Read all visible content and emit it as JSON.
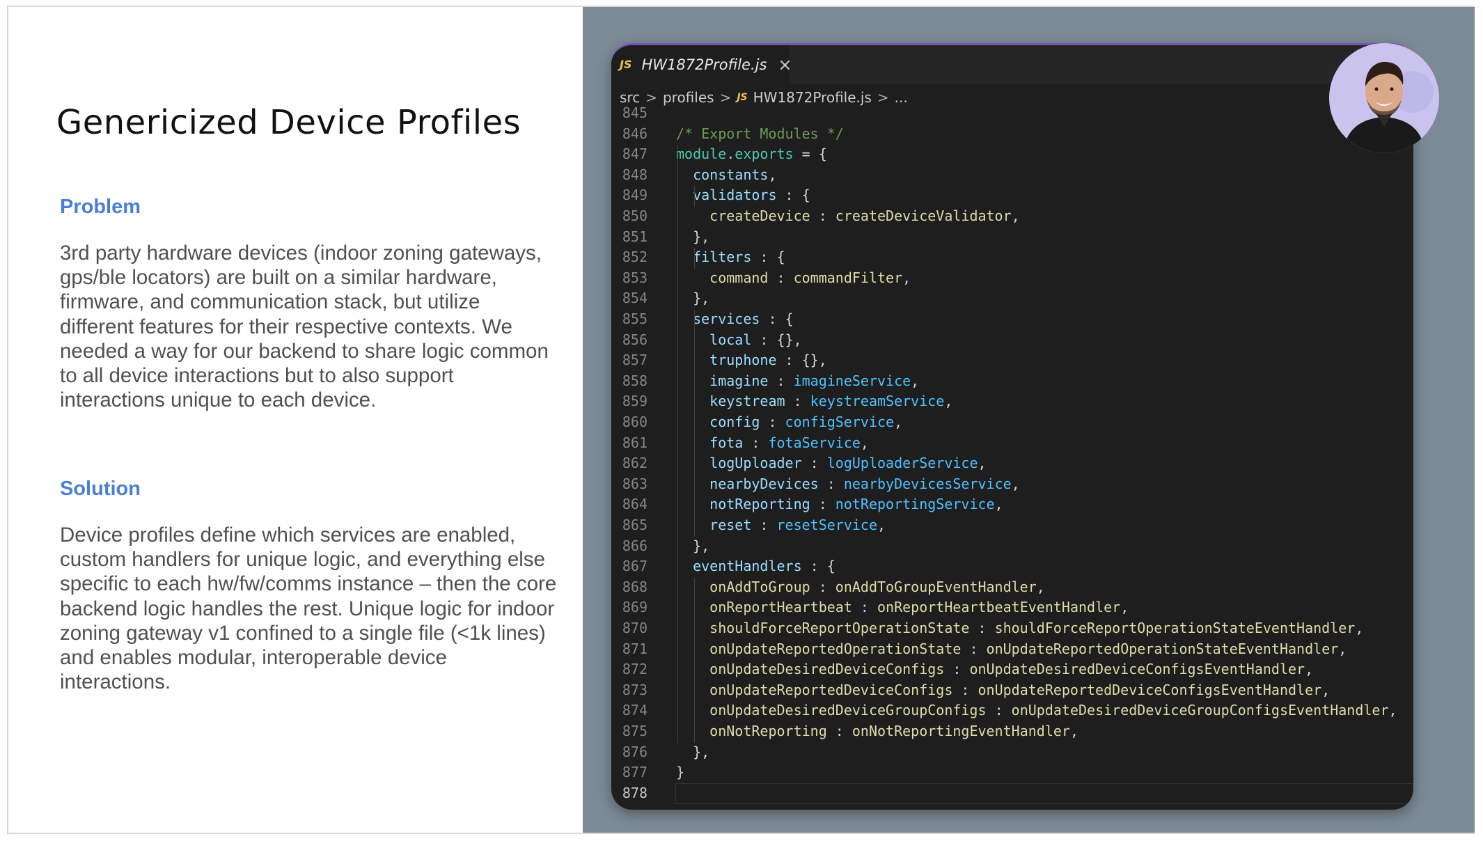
{
  "slide": {
    "title": "Genericized Device Profiles",
    "problem": {
      "heading": "Problem",
      "lines": [
        "3rd party hardware devices (indoor zoning gateways,",
        "gps/ble locators) are built on a similar hardware,",
        "firmware, and communication stack, but utilize",
        "different features for their respective contexts. We",
        "needed a way for our backend to share logic common",
        "to all device interactions but to also support",
        "interactions unique to each device."
      ]
    },
    "solution": {
      "heading": "Solution",
      "lines": [
        "Device profiles define which services are enabled,",
        "custom handlers for unique logic, and everything else",
        "specific to each hw/fw/comms instance – then the core",
        "backend logic handles the rest. Unique logic for indoor",
        "zoning gateway  v1 confined to a single file (<1k lines)",
        "and enables modular, interoperable device",
        "interactions."
      ]
    }
  },
  "editor": {
    "tab": {
      "badge": "JS",
      "filename": "HW1872Profile.js",
      "close": "×"
    },
    "breadcrumb": {
      "items": [
        "src",
        "profiles",
        "HW1872Profile.js",
        "..."
      ],
      "separator": ">",
      "file_badge": "JS"
    },
    "code_lines": [
      {
        "num": "845",
        "tokens": []
      },
      {
        "num": "846",
        "tokens": [
          {
            "t": "/* Export Modules */",
            "c": "comment"
          }
        ]
      },
      {
        "num": "847",
        "tokens": [
          {
            "t": "module",
            "c": "mod"
          },
          {
            "t": ".",
            "c": "punc"
          },
          {
            "t": "exports",
            "c": "mod"
          },
          {
            "t": " = {",
            "c": "punc"
          }
        ]
      },
      {
        "num": "848",
        "tokens": [
          {
            "t": "  constants",
            "c": "prop"
          },
          {
            "t": ",",
            "c": "punc"
          }
        ]
      },
      {
        "num": "849",
        "tokens": [
          {
            "t": "  validators",
            "c": "prop"
          },
          {
            "t": " : {",
            "c": "punc"
          }
        ]
      },
      {
        "num": "850",
        "tokens": [
          {
            "t": "    createDevice",
            "c": "func"
          },
          {
            "t": " : ",
            "c": "punc"
          },
          {
            "t": "createDeviceValidator",
            "c": "func"
          },
          {
            "t": ",",
            "c": "punc"
          }
        ]
      },
      {
        "num": "851",
        "tokens": [
          {
            "t": "  },",
            "c": "punc"
          }
        ]
      },
      {
        "num": "852",
        "tokens": [
          {
            "t": "  filters",
            "c": "prop"
          },
          {
            "t": " : {",
            "c": "punc"
          }
        ]
      },
      {
        "num": "853",
        "tokens": [
          {
            "t": "    command",
            "c": "func"
          },
          {
            "t": " : ",
            "c": "punc"
          },
          {
            "t": "commandFilter",
            "c": "func"
          },
          {
            "t": ",",
            "c": "punc"
          }
        ]
      },
      {
        "num": "854",
        "tokens": [
          {
            "t": "  },",
            "c": "punc"
          }
        ]
      },
      {
        "num": "855",
        "tokens": [
          {
            "t": "  services",
            "c": "prop"
          },
          {
            "t": " : {",
            "c": "punc"
          }
        ]
      },
      {
        "num": "856",
        "tokens": [
          {
            "t": "    local",
            "c": "prop"
          },
          {
            "t": " : {},",
            "c": "punc"
          }
        ]
      },
      {
        "num": "857",
        "tokens": [
          {
            "t": "    truphone",
            "c": "prop"
          },
          {
            "t": " : {},",
            "c": "punc"
          }
        ]
      },
      {
        "num": "858",
        "tokens": [
          {
            "t": "    imagine",
            "c": "prop"
          },
          {
            "t": " : ",
            "c": "punc"
          },
          {
            "t": "imagineService",
            "c": "svc"
          },
          {
            "t": ",",
            "c": "punc"
          }
        ]
      },
      {
        "num": "859",
        "tokens": [
          {
            "t": "    keystream",
            "c": "prop"
          },
          {
            "t": " : ",
            "c": "punc"
          },
          {
            "t": "keystreamService",
            "c": "svc"
          },
          {
            "t": ",",
            "c": "punc"
          }
        ]
      },
      {
        "num": "860",
        "tokens": [
          {
            "t": "    config",
            "c": "prop"
          },
          {
            "t": " : ",
            "c": "punc"
          },
          {
            "t": "configService",
            "c": "svc"
          },
          {
            "t": ",",
            "c": "punc"
          }
        ]
      },
      {
        "num": "861",
        "tokens": [
          {
            "t": "    fota",
            "c": "prop"
          },
          {
            "t": " : ",
            "c": "punc"
          },
          {
            "t": "fotaService",
            "c": "svc"
          },
          {
            "t": ",",
            "c": "punc"
          }
        ]
      },
      {
        "num": "862",
        "tokens": [
          {
            "t": "    logUploader",
            "c": "prop"
          },
          {
            "t": " : ",
            "c": "punc"
          },
          {
            "t": "logUploaderService",
            "c": "svc"
          },
          {
            "t": ",",
            "c": "punc"
          }
        ]
      },
      {
        "num": "863",
        "tokens": [
          {
            "t": "    nearbyDevices",
            "c": "prop"
          },
          {
            "t": " : ",
            "c": "punc"
          },
          {
            "t": "nearbyDevicesService",
            "c": "svc"
          },
          {
            "t": ",",
            "c": "punc"
          }
        ]
      },
      {
        "num": "864",
        "tokens": [
          {
            "t": "    notReporting",
            "c": "prop"
          },
          {
            "t": " : ",
            "c": "punc"
          },
          {
            "t": "notReportingService",
            "c": "svc"
          },
          {
            "t": ",",
            "c": "punc"
          }
        ]
      },
      {
        "num": "865",
        "tokens": [
          {
            "t": "    reset",
            "c": "prop"
          },
          {
            "t": " : ",
            "c": "punc"
          },
          {
            "t": "resetService",
            "c": "svc"
          },
          {
            "t": ",",
            "c": "punc"
          }
        ]
      },
      {
        "num": "866",
        "tokens": [
          {
            "t": "  },",
            "c": "punc"
          }
        ]
      },
      {
        "num": "867",
        "tokens": [
          {
            "t": "  eventHandlers",
            "c": "prop"
          },
          {
            "t": " : {",
            "c": "punc"
          }
        ]
      },
      {
        "num": "868",
        "tokens": [
          {
            "t": "    onAddToGroup",
            "c": "func"
          },
          {
            "t": " : ",
            "c": "punc"
          },
          {
            "t": "onAddToGroupEventHandler",
            "c": "func"
          },
          {
            "t": ",",
            "c": "punc"
          }
        ]
      },
      {
        "num": "869",
        "tokens": [
          {
            "t": "    onReportHeartbeat",
            "c": "func"
          },
          {
            "t": " : ",
            "c": "punc"
          },
          {
            "t": "onReportHeartbeatEventHandler",
            "c": "func"
          },
          {
            "t": ",",
            "c": "punc"
          }
        ]
      },
      {
        "num": "870",
        "tokens": [
          {
            "t": "    shouldForceReportOperationState",
            "c": "func"
          },
          {
            "t": " : ",
            "c": "punc"
          },
          {
            "t": "shouldForceReportOperationStateEventHandler",
            "c": "func"
          },
          {
            "t": ",",
            "c": "punc"
          }
        ]
      },
      {
        "num": "871",
        "tokens": [
          {
            "t": "    onUpdateReportedOperationState",
            "c": "func"
          },
          {
            "t": " : ",
            "c": "punc"
          },
          {
            "t": "onUpdateReportedOperationStateEventHandler",
            "c": "func"
          },
          {
            "t": ",",
            "c": "punc"
          }
        ]
      },
      {
        "num": "872",
        "tokens": [
          {
            "t": "    onUpdateDesiredDeviceConfigs",
            "c": "func"
          },
          {
            "t": " : ",
            "c": "punc"
          },
          {
            "t": "onUpdateDesiredDeviceConfigsEventHandler",
            "c": "func"
          },
          {
            "t": ",",
            "c": "punc"
          }
        ]
      },
      {
        "num": "873",
        "tokens": [
          {
            "t": "    onUpdateReportedDeviceConfigs",
            "c": "func"
          },
          {
            "t": " : ",
            "c": "punc"
          },
          {
            "t": "onUpdateReportedDeviceConfigsEventHandler",
            "c": "func"
          },
          {
            "t": ",",
            "c": "punc"
          }
        ]
      },
      {
        "num": "874",
        "tokens": [
          {
            "t": "    onUpdateDesiredDeviceGroupConfigs",
            "c": "func"
          },
          {
            "t": " : ",
            "c": "punc"
          },
          {
            "t": "onUpdateDesiredDeviceGroupConfigsEventHandler",
            "c": "func"
          },
          {
            "t": ",",
            "c": "punc"
          }
        ]
      },
      {
        "num": "875",
        "tokens": [
          {
            "t": "    onNotReporting",
            "c": "func"
          },
          {
            "t": " : ",
            "c": "punc"
          },
          {
            "t": "onNotReportingEventHandler",
            "c": "func"
          },
          {
            "t": ",",
            "c": "punc"
          }
        ]
      },
      {
        "num": "876",
        "tokens": [
          {
            "t": "  },",
            "c": "punc"
          }
        ]
      },
      {
        "num": "877",
        "tokens": [
          {
            "t": "}",
            "c": "punc"
          }
        ]
      },
      {
        "num": "878",
        "tokens": [],
        "active": true
      }
    ]
  },
  "avatar": {
    "icon": "presenter-avatar-icon"
  },
  "colors": {
    "heading_blue": "#4a7fd6",
    "right_bg": "#7c8a96",
    "editor_bg": "#1e1e1e",
    "comment": "#6a9955",
    "property": "#9cdcfe",
    "function": "#dcdcaa",
    "service": "#4fc1ff",
    "module": "#4ec9b0"
  }
}
